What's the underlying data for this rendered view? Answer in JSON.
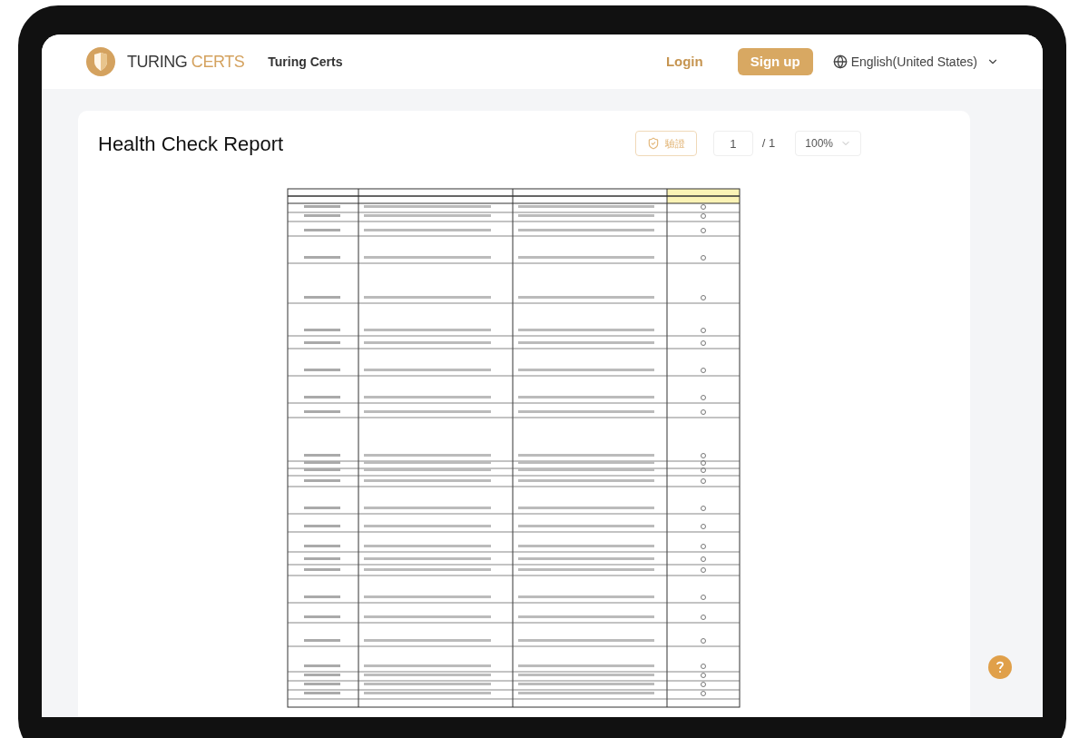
{
  "header": {
    "brand": {
      "name_main": "TURING",
      "name_accent": "CERTS"
    },
    "site_name": "Turing Certs",
    "login": "Login",
    "signup": "Sign up",
    "language": "English(United States)"
  },
  "document": {
    "title": "Health Check Report",
    "verify_button": "驗證",
    "page": "1",
    "page_total": "/ 1",
    "zoom": "100%"
  }
}
